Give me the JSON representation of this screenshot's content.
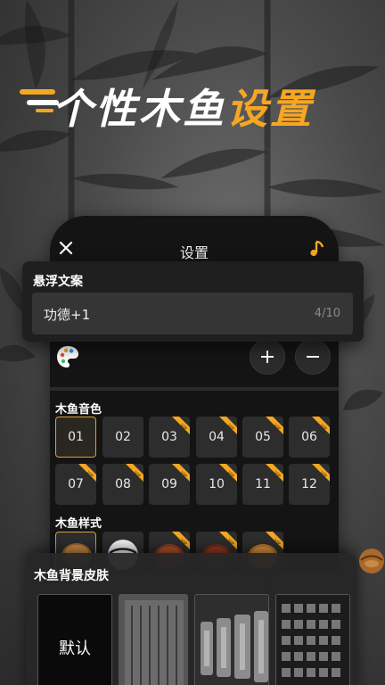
{
  "headline": {
    "part_white": "个性木鱼",
    "part_orange": "设置"
  },
  "topbar": {
    "title": "设置"
  },
  "floating_text": {
    "label": "悬浮文案",
    "value": "功德+1",
    "counter": "4/10"
  },
  "sound_section": {
    "title": "木鱼音色",
    "items": [
      "01",
      "02",
      "03",
      "04",
      "05",
      "06",
      "07",
      "08",
      "09",
      "10",
      "11",
      "12"
    ],
    "vip_label": "VIP"
  },
  "style_section": {
    "title": "木鱼样式"
  },
  "background_section": {
    "title": "木鱼背景皮肤",
    "default_label": "默认"
  },
  "colors": {
    "accent": "#f5a623",
    "selected_border": "#d9a23a",
    "panel": "#141414"
  }
}
